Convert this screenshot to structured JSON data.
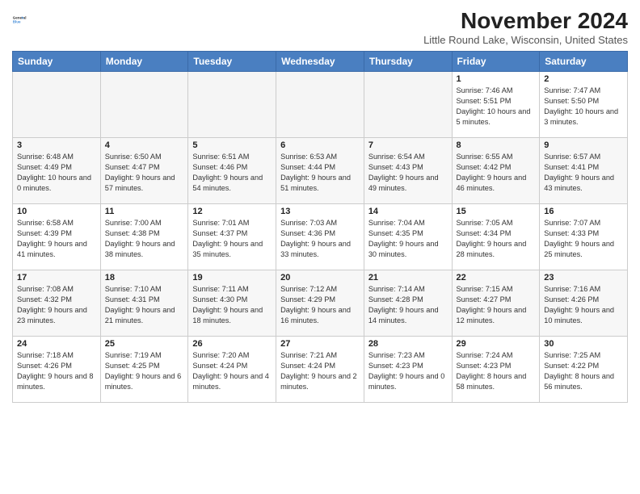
{
  "header": {
    "logo_line1": "General",
    "logo_line2": "Blue",
    "month_title": "November 2024",
    "location": "Little Round Lake, Wisconsin, United States"
  },
  "weekdays": [
    "Sunday",
    "Monday",
    "Tuesday",
    "Wednesday",
    "Thursday",
    "Friday",
    "Saturday"
  ],
  "weeks": [
    [
      {
        "day": "",
        "empty": true
      },
      {
        "day": "",
        "empty": true
      },
      {
        "day": "",
        "empty": true
      },
      {
        "day": "",
        "empty": true
      },
      {
        "day": "",
        "empty": true
      },
      {
        "day": "1",
        "rise": "7:46 AM",
        "set": "5:51 PM",
        "daylight": "10 hours and 5 minutes."
      },
      {
        "day": "2",
        "rise": "7:47 AM",
        "set": "5:50 PM",
        "daylight": "10 hours and 3 minutes."
      }
    ],
    [
      {
        "day": "3",
        "rise": "6:48 AM",
        "set": "4:49 PM",
        "daylight": "10 hours and 0 minutes."
      },
      {
        "day": "4",
        "rise": "6:50 AM",
        "set": "4:47 PM",
        "daylight": "9 hours and 57 minutes."
      },
      {
        "day": "5",
        "rise": "6:51 AM",
        "set": "4:46 PM",
        "daylight": "9 hours and 54 minutes."
      },
      {
        "day": "6",
        "rise": "6:53 AM",
        "set": "4:44 PM",
        "daylight": "9 hours and 51 minutes."
      },
      {
        "day": "7",
        "rise": "6:54 AM",
        "set": "4:43 PM",
        "daylight": "9 hours and 49 minutes."
      },
      {
        "day": "8",
        "rise": "6:55 AM",
        "set": "4:42 PM",
        "daylight": "9 hours and 46 minutes."
      },
      {
        "day": "9",
        "rise": "6:57 AM",
        "set": "4:41 PM",
        "daylight": "9 hours and 43 minutes."
      }
    ],
    [
      {
        "day": "10",
        "rise": "6:58 AM",
        "set": "4:39 PM",
        "daylight": "9 hours and 41 minutes."
      },
      {
        "day": "11",
        "rise": "7:00 AM",
        "set": "4:38 PM",
        "daylight": "9 hours and 38 minutes."
      },
      {
        "day": "12",
        "rise": "7:01 AM",
        "set": "4:37 PM",
        "daylight": "9 hours and 35 minutes."
      },
      {
        "day": "13",
        "rise": "7:03 AM",
        "set": "4:36 PM",
        "daylight": "9 hours and 33 minutes."
      },
      {
        "day": "14",
        "rise": "7:04 AM",
        "set": "4:35 PM",
        "daylight": "9 hours and 30 minutes."
      },
      {
        "day": "15",
        "rise": "7:05 AM",
        "set": "4:34 PM",
        "daylight": "9 hours and 28 minutes."
      },
      {
        "day": "16",
        "rise": "7:07 AM",
        "set": "4:33 PM",
        "daylight": "9 hours and 25 minutes."
      }
    ],
    [
      {
        "day": "17",
        "rise": "7:08 AM",
        "set": "4:32 PM",
        "daylight": "9 hours and 23 minutes."
      },
      {
        "day": "18",
        "rise": "7:10 AM",
        "set": "4:31 PM",
        "daylight": "9 hours and 21 minutes."
      },
      {
        "day": "19",
        "rise": "7:11 AM",
        "set": "4:30 PM",
        "daylight": "9 hours and 18 minutes."
      },
      {
        "day": "20",
        "rise": "7:12 AM",
        "set": "4:29 PM",
        "daylight": "9 hours and 16 minutes."
      },
      {
        "day": "21",
        "rise": "7:14 AM",
        "set": "4:28 PM",
        "daylight": "9 hours and 14 minutes."
      },
      {
        "day": "22",
        "rise": "7:15 AM",
        "set": "4:27 PM",
        "daylight": "9 hours and 12 minutes."
      },
      {
        "day": "23",
        "rise": "7:16 AM",
        "set": "4:26 PM",
        "daylight": "9 hours and 10 minutes."
      }
    ],
    [
      {
        "day": "24",
        "rise": "7:18 AM",
        "set": "4:26 PM",
        "daylight": "9 hours and 8 minutes."
      },
      {
        "day": "25",
        "rise": "7:19 AM",
        "set": "4:25 PM",
        "daylight": "9 hours and 6 minutes."
      },
      {
        "day": "26",
        "rise": "7:20 AM",
        "set": "4:24 PM",
        "daylight": "9 hours and 4 minutes."
      },
      {
        "day": "27",
        "rise": "7:21 AM",
        "set": "4:24 PM",
        "daylight": "9 hours and 2 minutes."
      },
      {
        "day": "28",
        "rise": "7:23 AM",
        "set": "4:23 PM",
        "daylight": "9 hours and 0 minutes."
      },
      {
        "day": "29",
        "rise": "7:24 AM",
        "set": "4:23 PM",
        "daylight": "8 hours and 58 minutes."
      },
      {
        "day": "30",
        "rise": "7:25 AM",
        "set": "4:22 PM",
        "daylight": "8 hours and 56 minutes."
      }
    ]
  ],
  "labels": {
    "sunrise": "Sunrise:",
    "sunset": "Sunset:",
    "daylight": "Daylight:"
  }
}
